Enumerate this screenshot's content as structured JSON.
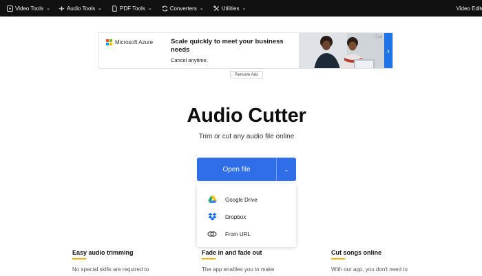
{
  "nav": {
    "items": [
      {
        "label": "Video Tools",
        "icon": "play-icon"
      },
      {
        "label": "Audio Tools",
        "icon": "audio-wave-icon"
      },
      {
        "label": "PDF Tools",
        "icon": "document-icon"
      },
      {
        "label": "Converters",
        "icon": "convert-icon"
      },
      {
        "label": "Utilities",
        "icon": "tools-icon"
      }
    ],
    "right_label": "Video Editor"
  },
  "ad": {
    "brand": "Microsoft Azure",
    "headline": "Scale quickly to meet your business needs",
    "subtext": "Cancel anytime.",
    "remove_label": "Remove Ads"
  },
  "hero": {
    "title": "Audio Cutter",
    "subtitle": "Trim or cut any audio file online"
  },
  "open_button": {
    "label": "Open file"
  },
  "dropdown": {
    "items": [
      {
        "label": "Google Drive",
        "icon": "google-drive-icon"
      },
      {
        "label": "Dropbox",
        "icon": "dropbox-icon"
      },
      {
        "label": "From URL",
        "icon": "link-icon"
      }
    ]
  },
  "features": [
    {
      "title": "Easy audio trimming",
      "text": "No special skills are required to"
    },
    {
      "title": "Fade in and fade out",
      "text": "The app enables you to make"
    },
    {
      "title": "Cut songs online",
      "text": "With our app, you don't need to"
    }
  ],
  "colors": {
    "nav_bg": "#111111",
    "primary": "#2f6ee8",
    "accent_rule": "#f2b400"
  }
}
